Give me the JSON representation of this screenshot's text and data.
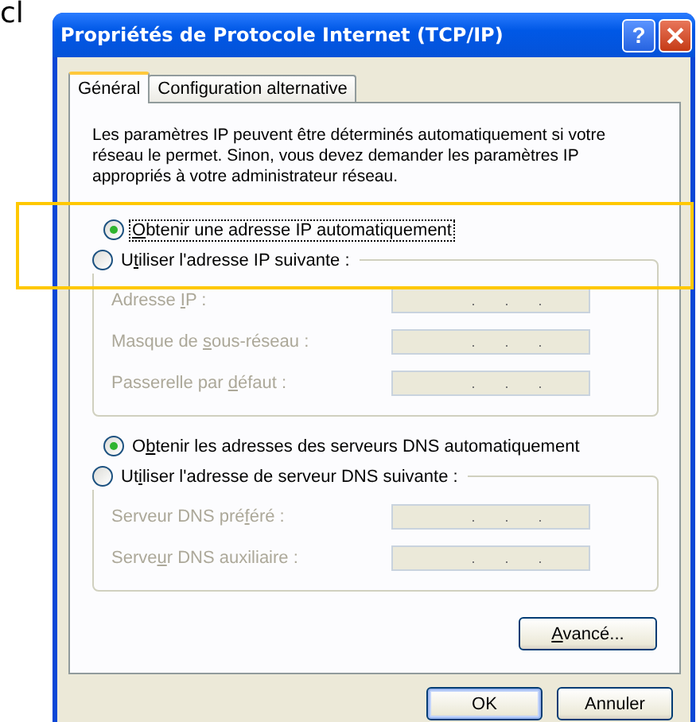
{
  "page_fragment": "cl",
  "window": {
    "title": "Propriétés de Protocole Internet (TCP/IP)",
    "buttons": [
      {
        "kind": "help",
        "label": "?"
      },
      {
        "kind": "close"
      }
    ]
  },
  "tabs": [
    {
      "label": "Général",
      "selected": true
    },
    {
      "label": "Configuration alternative",
      "selected": false
    }
  ],
  "description": "Les paramètres IP peuvent être déterminés automatiquement si votre réseau le permet. Sinon, vous devez demander les paramètres IP appropriés à votre administrateur réseau.",
  "highlight": {
    "shown": true
  },
  "sections": [
    {
      "auto_option": {
        "label": {
          "key": "O",
          "after": "btenir une adresse IP automatiquement"
        },
        "selected": true,
        "focused": true
      },
      "manual_option": {
        "label": {
          "before": "U",
          "key": "t",
          "after": "iliser l'adresse IP suivante :"
        },
        "selected": false
      },
      "fields": [
        {
          "label": {
            "before": "Adresse ",
            "key": "I",
            "after": "P :"
          },
          "disabled": true
        },
        {
          "label": {
            "before": "Masque de ",
            "key": "s",
            "after": "ous-réseau :"
          },
          "disabled": true
        },
        {
          "label": {
            "before": "Passerelle par ",
            "key": "d",
            "after": "éfaut :"
          },
          "disabled": true
        }
      ]
    },
    {
      "auto_option": {
        "label": {
          "before": "O",
          "key": "b",
          "after": "tenir les adresses des serveurs DNS automatiquement"
        },
        "selected": true,
        "focused": false
      },
      "manual_option": {
        "label": {
          "before": "Ut",
          "key": "i",
          "after": "liser l'adresse de serveur DNS suivante :"
        },
        "selected": false
      },
      "fields": [
        {
          "label": {
            "before": "Serveur DNS pré",
            "key": "f",
            "after": "éré :"
          },
          "disabled": true
        },
        {
          "label": {
            "before": "Serve",
            "key": "u",
            "after": "r DNS auxiliaire :"
          },
          "disabled": true
        }
      ]
    }
  ],
  "advanced_button": {
    "label": {
      "key": "A",
      "after": "vancé..."
    }
  },
  "footer_buttons": [
    {
      "label": "OK",
      "default": true
    },
    {
      "label": "Annuler",
      "default": false
    }
  ]
}
